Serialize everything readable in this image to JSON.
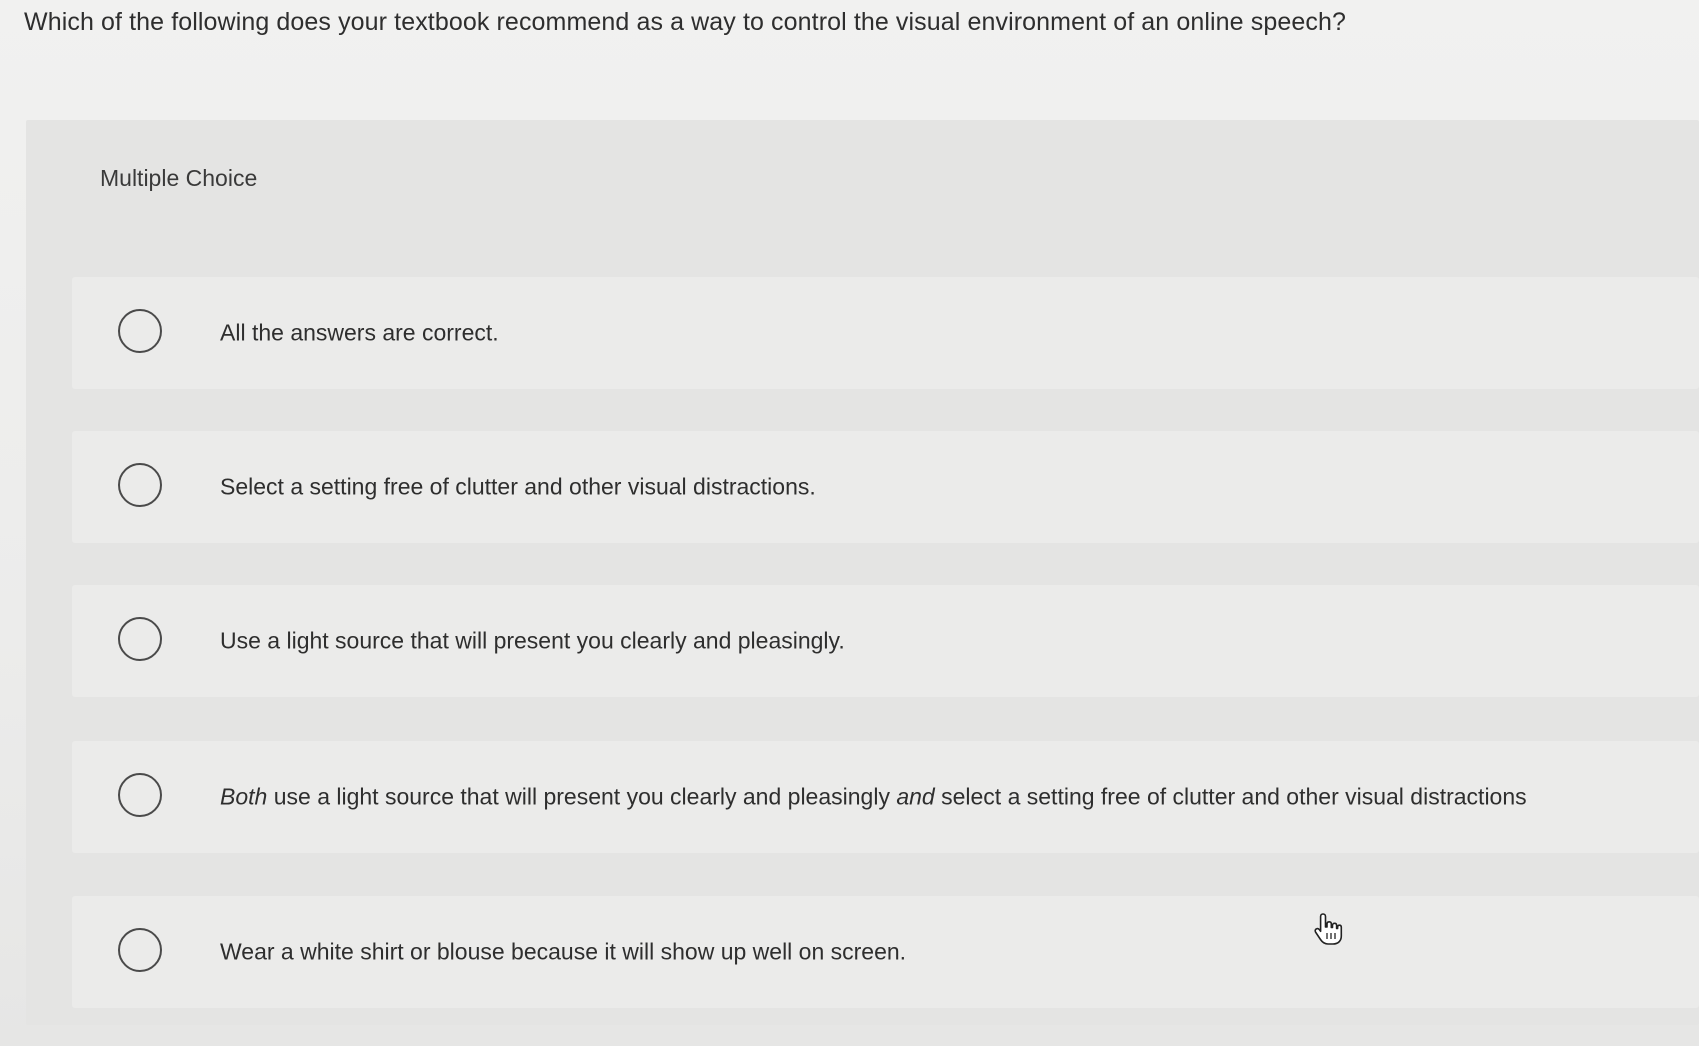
{
  "question": {
    "text": "Which of the following does your textbook recommend as a way to control the visual environment of an online speech?"
  },
  "panel": {
    "label": "Multiple Choice"
  },
  "options": [
    {
      "text": "All the answers are correct."
    },
    {
      "text": "Select a setting free of clutter and other visual distractions."
    },
    {
      "text": "Use a light source that will present you clearly and pleasingly."
    },
    {
      "part1": "Both",
      "part2": " use a light source that will present you clearly and pleasingly ",
      "part3": "and",
      "part4": " select a setting free of clutter and other visual distractions"
    },
    {
      "text": "Wear a white shirt or blouse because it will show up well on screen."
    }
  ],
  "cursor": {
    "icon": "hand-pointer-icon"
  }
}
